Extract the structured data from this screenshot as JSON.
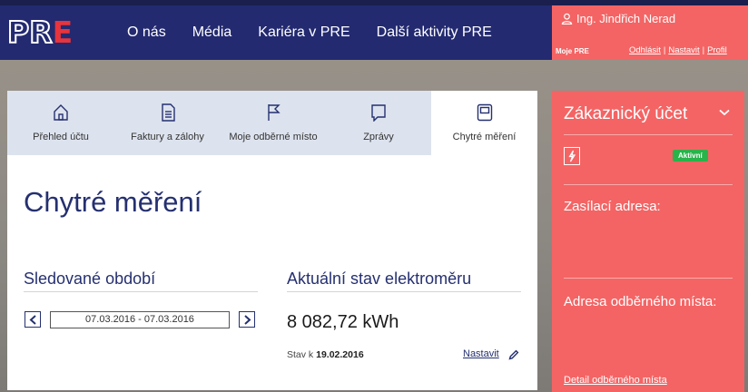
{
  "brand": {
    "logo_text": "PRE"
  },
  "nav": {
    "items": [
      "O nás",
      "Média",
      "Kariéra v PRE",
      "Další aktivity PRE"
    ]
  },
  "user": {
    "name": "Ing. Jindřich Nerad",
    "portal": "Moje PRE",
    "links": {
      "logout": "Odhlásit",
      "settings": "Nastavit",
      "profile": "Profil"
    },
    "separator": "|"
  },
  "tabs": [
    {
      "label": "Přehled účtu",
      "icon": "home-icon"
    },
    {
      "label": "Faktury a zálohy",
      "icon": "document-icon"
    },
    {
      "label": "Moje odběrné místo",
      "icon": "flag-icon"
    },
    {
      "label": "Zprávy",
      "icon": "message-icon"
    },
    {
      "label": "Chytré měření",
      "icon": "smart-meter-icon",
      "active": true
    }
  ],
  "main": {
    "title": "Chytré měření",
    "period": {
      "heading": "Sledované období",
      "range": "07.03.2016 - 07.03.2016"
    },
    "meter": {
      "heading": "Aktuální stav elektroměru",
      "value": "8 082,72 kWh",
      "state_prefix": "Stav k",
      "state_date": "19.02.2016",
      "set_label": "Nastavit"
    }
  },
  "account_panel": {
    "title": "Zákaznický účet",
    "status": "Aktivní",
    "mailing_label": "Zasílací adresa:",
    "supply_label": "Adresa odběrného místa:",
    "detail_link": "Detail odběrného místa"
  },
  "colors": {
    "navy": "#232a70",
    "coral": "#f46464",
    "tab_bg": "#dde3ee",
    "badge_green": "#29b34a",
    "logo_red": "#e8343c"
  }
}
